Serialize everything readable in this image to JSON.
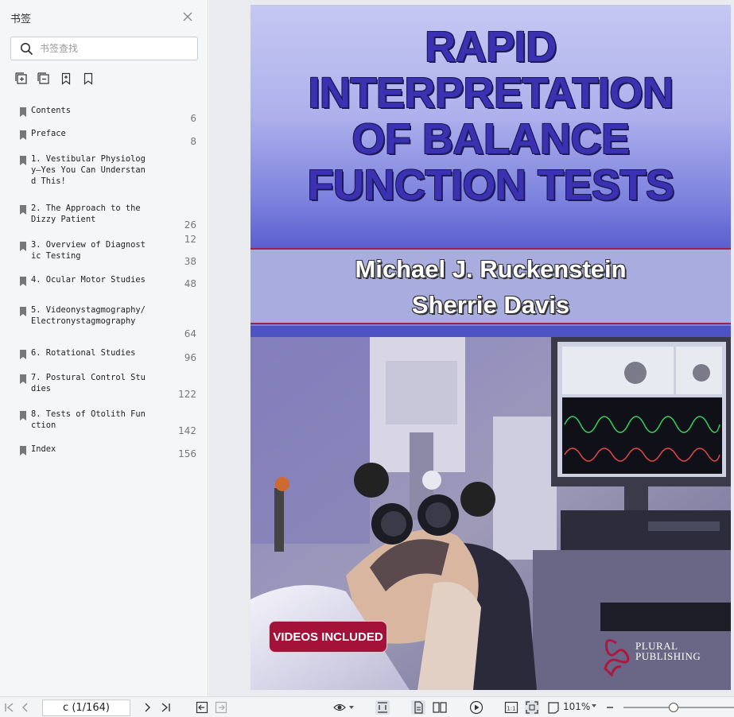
{
  "sidebar": {
    "title": "书签",
    "search_placeholder": "书签查找",
    "tools": [
      "expand-all-icon",
      "collapse-all-icon",
      "add-bookmark-icon",
      "bookmark-icon"
    ],
    "items": [
      {
        "label": "Contents",
        "page": "6"
      },
      {
        "label": "Preface",
        "page": "8"
      },
      {
        "label": "1. Vestibular Physiology—Yes You Can Understand This!",
        "page": "12"
      },
      {
        "label": "2. The Approach to the Dizzy Patient",
        "page": "26"
      },
      {
        "label": "3. Overview of Diagnostic Testing",
        "page": "38"
      },
      {
        "label": "4. Ocular Motor Studies",
        "page": "48"
      },
      {
        "label": "5. Videonystagmography/\nElectronystagmography",
        "page": "64"
      },
      {
        "label": "6. Rotational Studies",
        "page": "96"
      },
      {
        "label": "7. Postural Control Studies",
        "page": "122"
      },
      {
        "label": "8. Tests of Otolith Function",
        "page": "142"
      },
      {
        "label": "Index",
        "page": "156"
      }
    ]
  },
  "cover": {
    "title": "RAPID\nINTERPRETATION\nOF BALANCE\nFUNCTION TESTS",
    "authors": "Michael J. Ruckenstein\nSherrie Davis",
    "badge": "VIDEOS INCLUDED",
    "publisher_line1": "PLURAL",
    "publisher_line2": "PUBLISHING",
    "colors": {
      "title": "#3a32b3",
      "band_border": "#a0234a",
      "badge": "#a4123a"
    }
  },
  "toolbar": {
    "page_field": "c (1/164)",
    "zoom": "101%",
    "zoom_fraction": 0.45
  }
}
